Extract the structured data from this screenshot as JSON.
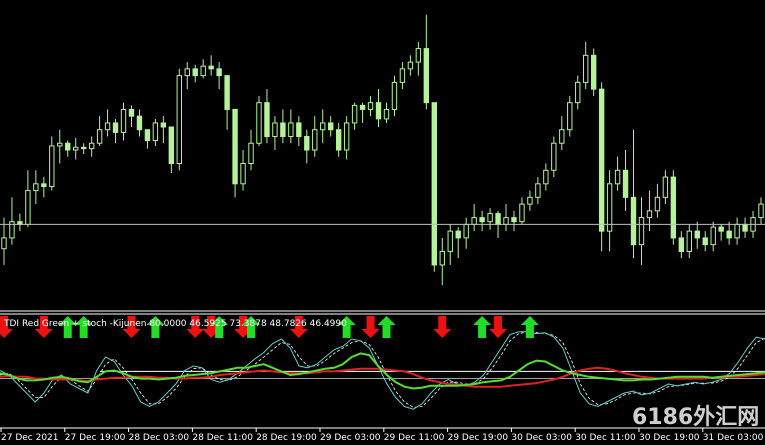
{
  "colors": {
    "background": "#000000",
    "candle_bull": "#b6f29a",
    "candle_bear": "#b6f29a",
    "wick": "#b6f29a",
    "grid_line": "#bfbfbf",
    "separator": "#ffffff",
    "up_arrow": "#22dd22",
    "down_arrow": "#ee1111",
    "tdi_red": "#dd2222",
    "tdi_green": "#55dd33",
    "stoch_main": "#66cccc",
    "stoch_signal": "#ffffff",
    "level_line": "#ffffff"
  },
  "indicator": {
    "label": "TDI Red Green + stoch -Kijunen 80.0000 46.5925 73.3878 48.7826 46.4990"
  },
  "watermark": {
    "text": "6186外汇网"
  },
  "time_axis": {
    "labels": [
      "27 Dec 2021",
      "27 Dec 19:00",
      "28 Dec 03:00",
      "28 Dec 11:00",
      "28 Dec 19:00",
      "29 Dec 03:00",
      "29 Dec 11:00",
      "29 Dec 19:00",
      "30 Dec 03:00",
      "30 Dec 11:00",
      "30 Dec 19:00",
      "31 Dec 03:00"
    ]
  },
  "chart_data": {
    "type": "candlestick",
    "candles": [
      [
        22,
        30,
        10,
        45
      ],
      [
        30,
        42,
        25,
        60
      ],
      [
        42,
        40,
        35,
        48
      ],
      [
        40,
        65,
        38,
        80
      ],
      [
        65,
        70,
        55,
        80
      ],
      [
        70,
        68,
        60,
        75
      ],
      [
        68,
        98,
        65,
        105
      ],
      [
        98,
        100,
        85,
        110
      ],
      [
        100,
        95,
        90,
        102
      ],
      [
        95,
        97,
        88,
        104
      ],
      [
        97,
        96,
        92,
        100
      ],
      [
        96,
        100,
        90,
        105
      ],
      [
        100,
        110,
        98,
        120
      ],
      [
        110,
        115,
        105,
        125
      ],
      [
        115,
        108,
        100,
        118
      ],
      [
        108,
        125,
        102,
        130
      ],
      [
        125,
        120,
        112,
        128
      ],
      [
        120,
        110,
        105,
        125
      ],
      [
        110,
        102,
        96,
        108
      ],
      [
        102,
        115,
        98,
        118
      ],
      [
        115,
        112,
        100,
        120
      ],
      [
        112,
        85,
        78,
        100
      ],
      [
        85,
        150,
        80,
        155
      ],
      [
        150,
        155,
        140,
        160
      ],
      [
        155,
        150,
        145,
        158
      ],
      [
        150,
        157,
        148,
        162
      ],
      [
        157,
        155,
        150,
        165
      ],
      [
        155,
        150,
        140,
        160
      ],
      [
        150,
        125,
        110,
        130
      ],
      [
        125,
        70,
        60,
        80
      ],
      [
        70,
        85,
        65,
        95
      ],
      [
        85,
        100,
        80,
        110
      ],
      [
        100,
        130,
        98,
        135
      ],
      [
        130,
        105,
        100,
        140
      ],
      [
        105,
        115,
        95,
        120
      ],
      [
        115,
        105,
        100,
        125
      ],
      [
        105,
        115,
        100,
        125
      ],
      [
        115,
        105,
        98,
        120
      ],
      [
        105,
        95,
        85,
        110
      ],
      [
        95,
        110,
        90,
        120
      ],
      [
        110,
        115,
        100,
        125
      ],
      [
        115,
        110,
        105,
        120
      ],
      [
        110,
        95,
        90,
        115
      ],
      [
        95,
        115,
        88,
        120
      ],
      [
        115,
        128,
        110,
        130
      ],
      [
        128,
        125,
        115,
        130
      ],
      [
        125,
        130,
        120,
        135
      ],
      [
        130,
        118,
        112,
        140
      ],
      [
        118,
        125,
        115,
        130
      ],
      [
        125,
        145,
        120,
        150
      ],
      [
        145,
        155,
        140,
        160
      ],
      [
        155,
        160,
        150,
        165
      ],
      [
        160,
        170,
        150,
        175
      ],
      [
        170,
        130,
        125,
        195
      ],
      [
        130,
        10,
        5,
        30
      ],
      [
        10,
        20,
        -5,
        30
      ],
      [
        20,
        35,
        10,
        40
      ],
      [
        35,
        30,
        15,
        38
      ],
      [
        30,
        40,
        22,
        45
      ],
      [
        40,
        45,
        35,
        55
      ],
      [
        45,
        42,
        35,
        50
      ],
      [
        42,
        48,
        36,
        52
      ],
      [
        48,
        40,
        30,
        50
      ],
      [
        40,
        45,
        35,
        55
      ],
      [
        45,
        42,
        35,
        50
      ],
      [
        42,
        55,
        40,
        60
      ],
      [
        55,
        60,
        50,
        65
      ],
      [
        60,
        70,
        55,
        75
      ],
      [
        70,
        80,
        65,
        85
      ],
      [
        80,
        100,
        75,
        105
      ],
      [
        100,
        110,
        95,
        120
      ],
      [
        110,
        130,
        105,
        135
      ],
      [
        130,
        145,
        125,
        150
      ],
      [
        145,
        165,
        140,
        175
      ],
      [
        165,
        140,
        135,
        170
      ],
      [
        140,
        35,
        20,
        145
      ],
      [
        35,
        70,
        20,
        80
      ],
      [
        70,
        80,
        65,
        90
      ],
      [
        80,
        60,
        50,
        95
      ],
      [
        60,
        25,
        15,
        110
      ],
      [
        25,
        45,
        10,
        60
      ],
      [
        45,
        50,
        35,
        65
      ],
      [
        50,
        60,
        45,
        70
      ],
      [
        60,
        75,
        55,
        80
      ],
      [
        75,
        30,
        25,
        80
      ],
      [
        30,
        20,
        15,
        35
      ],
      [
        20,
        35,
        15,
        40
      ],
      [
        35,
        30,
        22,
        42
      ],
      [
        30,
        25,
        20,
        35
      ],
      [
        25,
        38,
        20,
        42
      ],
      [
        38,
        35,
        28,
        40
      ],
      [
        35,
        30,
        25,
        42
      ],
      [
        30,
        40,
        25,
        45
      ],
      [
        40,
        35,
        30,
        45
      ],
      [
        35,
        45,
        30,
        50
      ],
      [
        45,
        55,
        40,
        60
      ]
    ],
    "current_price_level": 40,
    "indicator_series": {
      "red": [
        48,
        49,
        48,
        48,
        46,
        46,
        45,
        45,
        45,
        44,
        43,
        45,
        46,
        47,
        47,
        48,
        48,
        48,
        47,
        47,
        46,
        46,
        47,
        47,
        48,
        50,
        51,
        52,
        53,
        54,
        55,
        54,
        53,
        52,
        52,
        52,
        53,
        54,
        54,
        55,
        56,
        57,
        57,
        57,
        56,
        55,
        54,
        51,
        47,
        44,
        42,
        40,
        39,
        38,
        37,
        37,
        37,
        37,
        38,
        39,
        40,
        41,
        43,
        45,
        48,
        52,
        55,
        57,
        58,
        57,
        55,
        52,
        50,
        48,
        47,
        46,
        46,
        46,
        46,
        46,
        46,
        47,
        47,
        48,
        48,
        49,
        50,
        51
      ],
      "green": [
        52,
        50,
        46,
        44,
        44,
        45,
        47,
        48,
        46,
        43,
        42,
        48,
        54,
        55,
        52,
        48,
        46,
        46,
        45,
        46,
        47,
        49,
        50,
        51,
        52,
        54,
        56,
        58,
        58,
        60,
        62,
        58,
        54,
        50,
        51,
        53,
        55,
        57,
        58,
        62,
        70,
        74,
        72,
        60,
        50,
        42,
        37,
        35,
        36,
        38,
        38,
        38,
        38,
        39,
        40,
        42,
        43,
        44,
        48,
        55,
        62,
        66,
        65,
        60,
        55,
        52,
        50,
        48,
        47,
        46,
        45,
        44,
        44,
        45,
        45,
        46,
        47,
        48,
        48,
        48,
        48,
        47,
        48,
        49,
        50,
        51,
        52,
        53
      ],
      "stoch_main": [
        55,
        50,
        40,
        30,
        20,
        30,
        45,
        50,
        40,
        35,
        30,
        55,
        70,
        65,
        50,
        38,
        20,
        15,
        20,
        30,
        40,
        55,
        60,
        58,
        45,
        42,
        45,
        52,
        60,
        68,
        75,
        85,
        90,
        80,
        60,
        58,
        62,
        70,
        78,
        82,
        90,
        88,
        80,
        60,
        40,
        25,
        15,
        12,
        18,
        30,
        40,
        45,
        40,
        38,
        42,
        50,
        65,
        80,
        95,
        98,
        98,
        96,
        97,
        92,
        80,
        55,
        30,
        18,
        15,
        20,
        25,
        30,
        32,
        28,
        30,
        35,
        40,
        38,
        40,
        42,
        40,
        42,
        45,
        52,
        65,
        80,
        92,
        90
      ],
      "stoch_signal": [
        50,
        52,
        45,
        35,
        25,
        25,
        38,
        48,
        45,
        38,
        32,
        45,
        62,
        68,
        58,
        45,
        30,
        18,
        18,
        25,
        35,
        48,
        57,
        58,
        50,
        45,
        44,
        48,
        55,
        62,
        70,
        78,
        86,
        84,
        70,
        60,
        60,
        66,
        74,
        80,
        86,
        88,
        84,
        70,
        50,
        32,
        20,
        14,
        15,
        24,
        35,
        42,
        42,
        40,
        40,
        46,
        58,
        72,
        88,
        96,
        98,
        97,
        96,
        94,
        86,
        66,
        40,
        24,
        17,
        18,
        22,
        28,
        30,
        30,
        29,
        32,
        37,
        38,
        39,
        41,
        41,
        41,
        43,
        48,
        58,
        72,
        86,
        91
      ],
      "level_high": 54,
      "level_low": 46
    },
    "signals": [
      {
        "bar": 0,
        "dir": "down"
      },
      {
        "bar": 5,
        "dir": "down"
      },
      {
        "bar": 8,
        "dir": "up"
      },
      {
        "bar": 10,
        "dir": "up"
      },
      {
        "bar": 16,
        "dir": "down"
      },
      {
        "bar": 19,
        "dir": "up"
      },
      {
        "bar": 24,
        "dir": "down"
      },
      {
        "bar": 26,
        "dir": "down"
      },
      {
        "bar": 27,
        "dir": "up"
      },
      {
        "bar": 30,
        "dir": "down"
      },
      {
        "bar": 31,
        "dir": "up"
      },
      {
        "bar": 37,
        "dir": "down"
      },
      {
        "bar": 43,
        "dir": "up"
      },
      {
        "bar": 46,
        "dir": "down"
      },
      {
        "bar": 48,
        "dir": "up"
      },
      {
        "bar": 55,
        "dir": "down"
      },
      {
        "bar": 60,
        "dir": "up"
      },
      {
        "bar": 62,
        "dir": "down"
      },
      {
        "bar": 66,
        "dir": "up"
      }
    ]
  }
}
